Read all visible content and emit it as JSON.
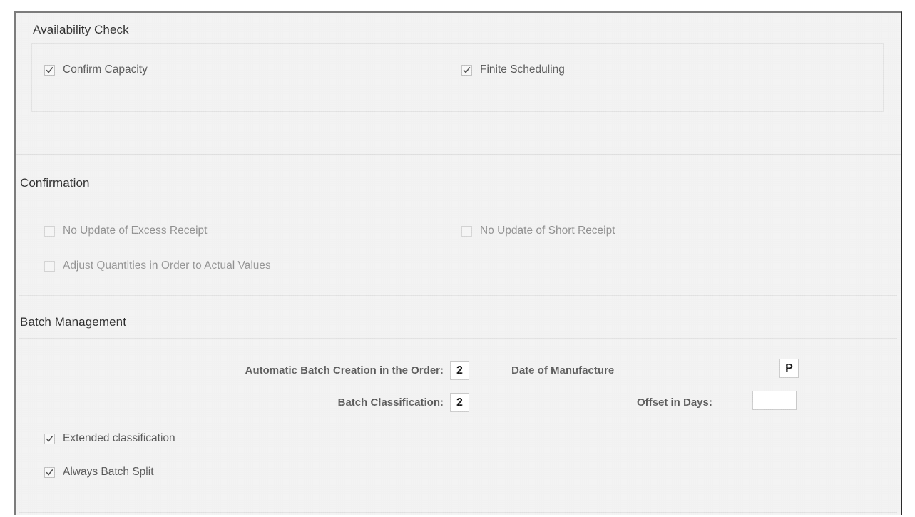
{
  "window": {
    "background_color": "#f1f1f1",
    "border_color": "#7c7c7c"
  },
  "sections": [
    {
      "id": "availability-check",
      "title": "Availability Check",
      "checkboxes": [
        {
          "label": "Confirm Capacity",
          "checked": true,
          "disabled": false,
          "column": "left"
        },
        {
          "label": "Finite Scheduling",
          "checked": true,
          "disabled": false,
          "column": "right"
        }
      ]
    },
    {
      "id": "confirmation",
      "title": "Confirmation",
      "checkboxes": [
        {
          "label": "No Update of Excess Receipt",
          "checked": false,
          "disabled": true,
          "column": "left"
        },
        {
          "label": "No Update of Short Receipt",
          "checked": false,
          "disabled": true,
          "column": "right"
        },
        {
          "label": "Adjust Quantities in Order to Actual Values",
          "checked": false,
          "disabled": true,
          "column": "left"
        }
      ]
    },
    {
      "id": "batch-management",
      "title": "Batch Management",
      "fields": [
        {
          "label": "Automatic Batch Creation in the Order:",
          "value": "2"
        },
        {
          "label": "Batch Classification:",
          "value": "2"
        },
        {
          "label": "Date of Manufacture",
          "value": "P"
        },
        {
          "label": "Offset in Days:",
          "value": ""
        }
      ],
      "checkboxes": [
        {
          "label": "Extended classification",
          "checked": true,
          "disabled": false,
          "column": "left"
        },
        {
          "label": "Always Batch Split",
          "checked": true,
          "disabled": false,
          "column": "left"
        }
      ]
    }
  ]
}
